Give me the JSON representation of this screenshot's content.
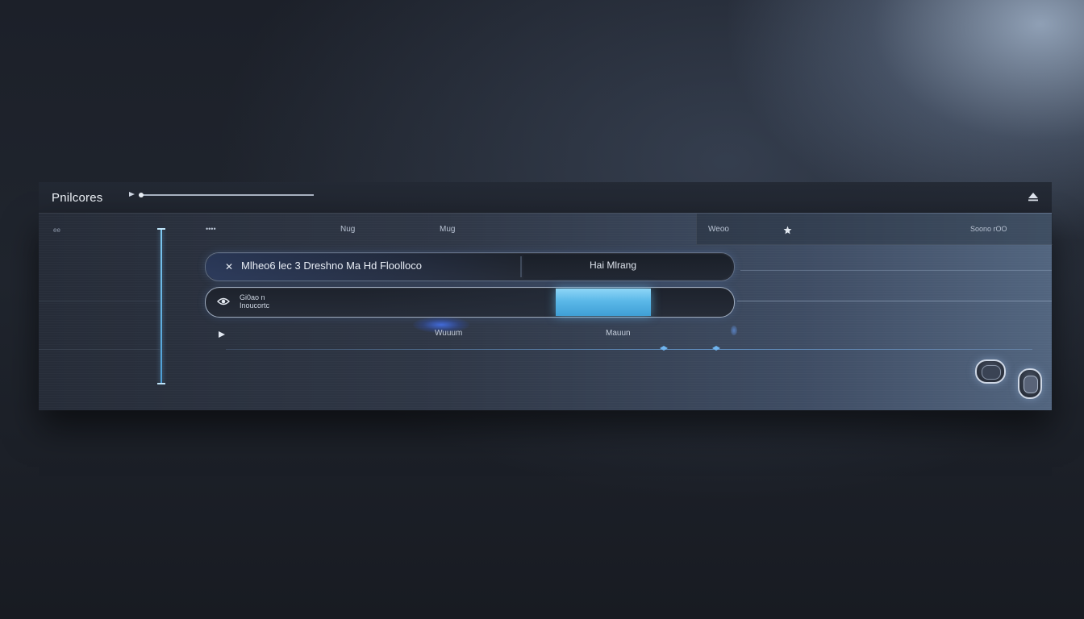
{
  "app": {
    "title": "Pnilcores"
  },
  "header": {
    "left_small": "ee",
    "col_a": "••••",
    "col_b": "Nug",
    "col_c": "Mug",
    "col_d": "Weoo",
    "col_e": "Soono rOO"
  },
  "row1": {
    "primary_label": "Mlheo6 lec 3 Dreshno Ma Hd Floolloco",
    "secondary_label": "Hai Mlrang"
  },
  "row2": {
    "meta_line1": "Gi0ao n",
    "meta_line2": "Inoucortc",
    "progress_fraction": 0.75
  },
  "row3": {
    "label_a": "Wuuum",
    "label_b": "Mauun"
  },
  "colors": {
    "accent": "#5bb8e8",
    "glow": "#4678ff",
    "text": "#d6dde8"
  },
  "icons": {
    "title_play": "play-mini-icon",
    "eject": "eject-icon",
    "header_mid": "star-icon",
    "row1_lead": "shuffle-icon",
    "row2_lead": "eye-icon",
    "row3_lead": "play-icon"
  }
}
